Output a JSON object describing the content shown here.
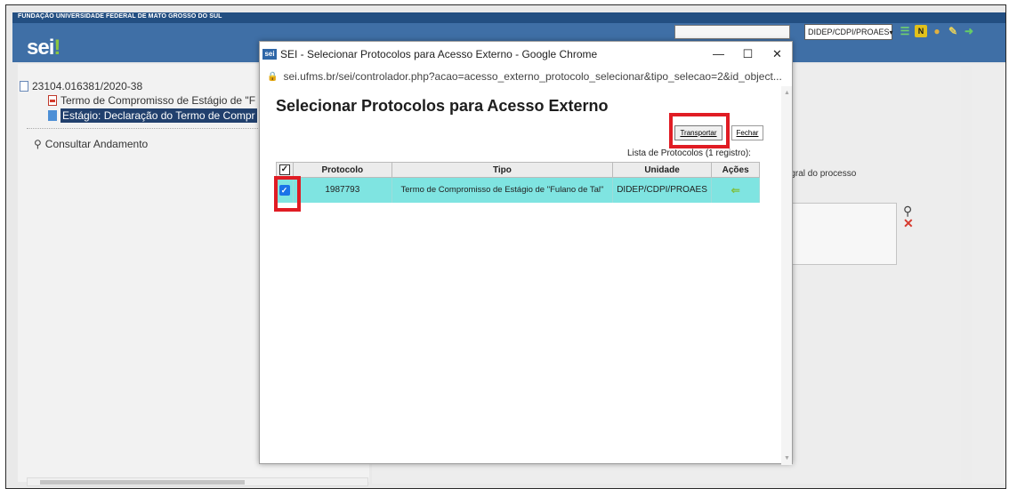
{
  "app": {
    "org_name": "FUNDAÇÃO UNIVERSIDADE FEDERAL DE MATO GROSSO DO SUL",
    "logo_text": "sei",
    "logo_dot": "!",
    "unit_select_value": "DIDEP/CDPI/PROAES",
    "top_icons": [
      "list-icon",
      "notes-icon",
      "user-icon",
      "tools-icon",
      "exit-icon"
    ],
    "n_icon_label": "N"
  },
  "tree": {
    "process_number": "23104.016381/2020-38",
    "doc1_label": "Termo de Compromisso de Estágio de \"F",
    "doc2_label": "Estágio: Declaração do Termo de Compr",
    "consult_label": "Consultar Andamento"
  },
  "right_panel": {
    "integral_label": "tegral do processo"
  },
  "popup": {
    "window_title": "SEI - Selecionar Protocolos para Acesso Externo - Google Chrome",
    "favicon_text": "sei",
    "url": "sei.ufms.br/sei/controlador.php?acao=acesso_externo_protocolo_selecionar&tipo_selecao=2&id_object...",
    "heading": "Selecionar Protocolos para Acesso Externo",
    "transport_button": "Transportar",
    "close_button": "Fechar",
    "table_caption": "Lista de Protocolos (1 registro):",
    "columns": [
      "Protocolo",
      "Tipo",
      "Unidade",
      "Ações"
    ],
    "rows": [
      {
        "checked": true,
        "protocolo": "1987793",
        "tipo": "Termo de Compromisso de Estágio de \"Fulano de Tal\"",
        "unidade": "DIDEP/CDPI/PROAES",
        "acao_icon": "transport-arrow-icon"
      }
    ]
  },
  "colors": {
    "header_blue": "#3f6fa6",
    "row_highlight": "#7fe4e1",
    "annotation_red": "#e01c24",
    "selected_tree_bg": "#21406d"
  }
}
